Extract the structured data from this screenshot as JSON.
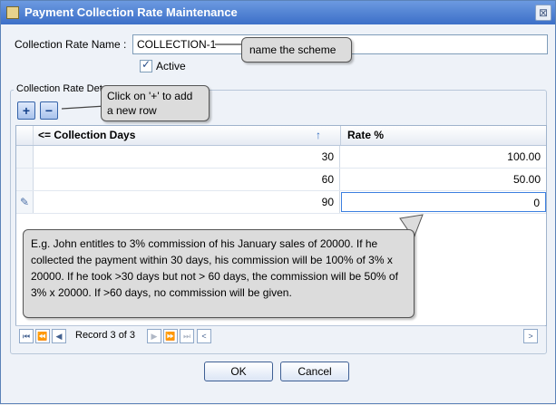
{
  "window": {
    "title": "Payment Collection Rate Maintenance",
    "icon": "app-icon",
    "close_glyph": "⊠"
  },
  "form": {
    "name_label": "Collection Rate Name :",
    "name_value": "COLLECTION-1",
    "active_label": "Active",
    "active_checked": true
  },
  "group": {
    "title": "Collection Rate Deta"
  },
  "toolbar": {
    "add": "+",
    "remove": "−"
  },
  "grid": {
    "columns": [
      "<= Collection Days",
      "Rate %"
    ],
    "sort_indicator": "↑",
    "rows": [
      {
        "days": "30",
        "rate": "100.00",
        "editing": false
      },
      {
        "days": "60",
        "rate": "50.00",
        "editing": false
      },
      {
        "days": "90",
        "rate": "0",
        "editing": true
      }
    ],
    "edit_row_marker": "✎"
  },
  "navigator": {
    "record_text": "Record 3 of 3",
    "buttons": [
      "⏮",
      "⏪",
      "◀",
      "▶",
      "⏩",
      "⏭",
      "<",
      ">"
    ]
  },
  "callouts": {
    "name": "name the scheme",
    "add": "Click on '+' to add\na new row",
    "example": "E.g. John entitles to 3% commission of his January sales of 20000. If he collected the payment within 30 days, his commission will be 100% of 3% x 20000. If he took >30 days but not > 60 days, the commission will be 50% of 3% x 20000. If >60 days, no commission will be given."
  },
  "buttons": {
    "ok": "OK",
    "cancel": "Cancel"
  }
}
